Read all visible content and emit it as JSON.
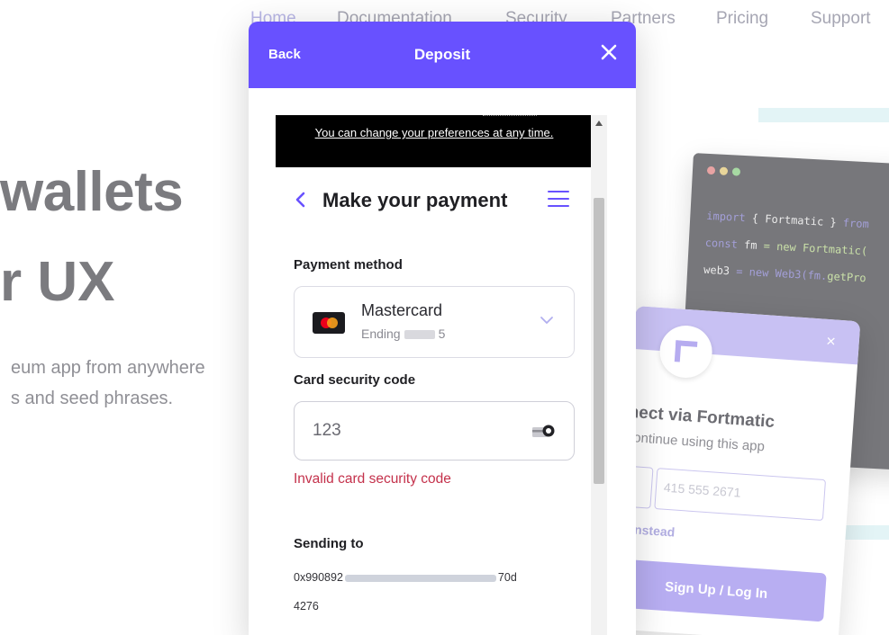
{
  "background": {
    "nav": [
      "Home",
      "Documentation",
      "Security",
      "Partners",
      "Pricing",
      "Support"
    ],
    "hero_line_1": "wallets",
    "hero_line_2": "r UX",
    "sub_line_1": "eum app from anywhere",
    "sub_line_2": "s and seed phrases.",
    "code_lines": [
      {
        "kw": "import",
        "rest": " { Fortmatic } ",
        "tail": "from"
      },
      {
        "kw": "const",
        "rest": " fm ",
        "tail": "= new Fortmatic("
      },
      {
        "kw": "web3",
        "rest": " = new Web3(fm.",
        "tail": "getPro"
      }
    ],
    "widget": {
      "title": "nect via Fortmatic",
      "subtitle": "continue using this app",
      "phone_placeholder": "415 555 2671",
      "link": "il Instead",
      "button": "Sign Up / Log In"
    },
    "colors": {
      "accent": "#6851ff",
      "code_bg": "#77777b"
    }
  },
  "modal": {
    "back": "Back",
    "title": "Deposit",
    "close_icon": "close-icon",
    "cookie_notice": "You can change your preferences at any time.",
    "payment": {
      "title": "Make your payment",
      "method_label": "Payment method",
      "method": {
        "name": "Mastercard",
        "ending_prefix": "Ending",
        "ending_suffix": "5"
      },
      "cvc_label": "Card security code",
      "cvc_value": "123",
      "cvc_error": "Invalid card security code",
      "sending_label": "Sending to",
      "address_start": "0x990892",
      "address_end": "70d",
      "address_line_2": "4276"
    },
    "colors": {
      "header": "#6851ff",
      "error": "#c4314b"
    }
  }
}
